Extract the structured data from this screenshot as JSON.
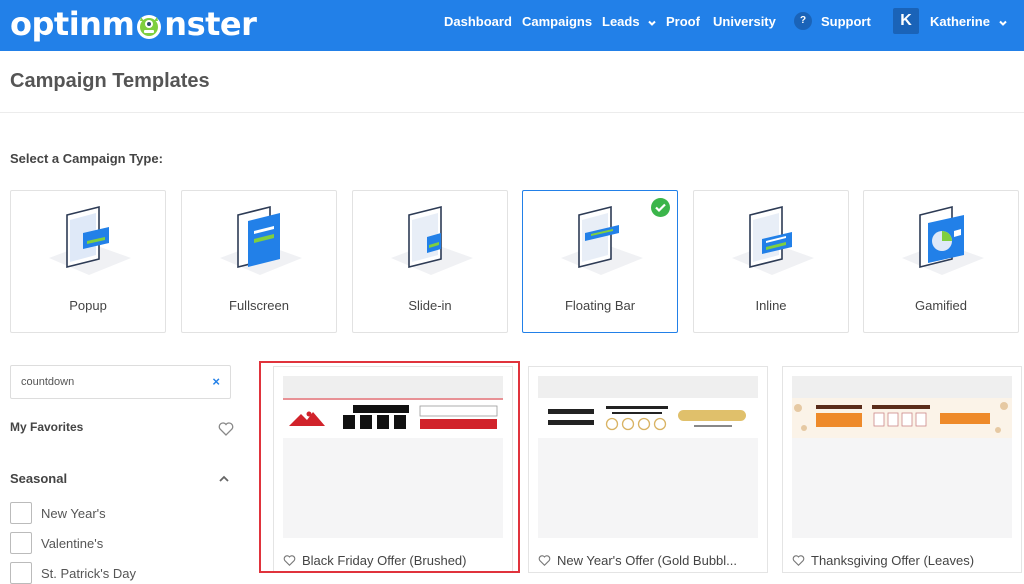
{
  "nav": {
    "logo_pre": "optinm",
    "logo_post": "nster",
    "links": [
      "Dashboard",
      "Campaigns",
      "Leads",
      "Proof",
      "University"
    ],
    "help_glyph": "?",
    "support": "Support",
    "avatar_initial": "K",
    "user_name": "Katherine"
  },
  "page": {
    "title": "Campaign Templates"
  },
  "campaign_types": {
    "heading": "Select a Campaign Type:",
    "items": [
      "Popup",
      "Fullscreen",
      "Slide-in",
      "Floating Bar",
      "Inline",
      "Gamified"
    ],
    "selected": "Floating Bar"
  },
  "sidebar": {
    "search_value": "countdown",
    "clear_glyph": "×",
    "favorites": "My Favorites",
    "seasonal": "Seasonal",
    "seasonal_items": [
      "New Year's",
      "Valentine's",
      "St. Patrick's Day"
    ]
  },
  "templates": [
    {
      "name": "Black Friday Offer (Brushed)"
    },
    {
      "name": "New Year's Offer (Gold Bubbl..."
    },
    {
      "name": "Thanksgiving Offer (Leaves)"
    }
  ],
  "colors": {
    "brand_blue": "#2280e8",
    "selected_check": "#3bb54a",
    "highlight_red": "#e0333c"
  }
}
